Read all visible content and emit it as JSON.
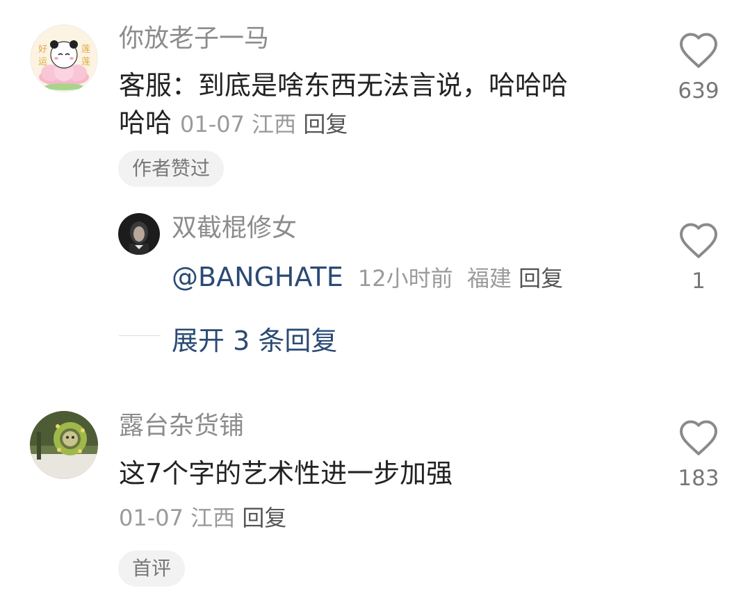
{
  "comments": [
    {
      "nickname": "你放老子一马",
      "content_line1": "客服：到底是啥东西无法言说，哈哈哈",
      "content_line2": "哈哈",
      "date": "01-07",
      "location": "江西",
      "reply_label": "回复",
      "badge": "作者赞过",
      "likes": "639",
      "avatar_icon": "panda-lotus-avatar",
      "avatar_text": {
        "left_top": "好",
        "left_bottom": "运",
        "right_top": "莲",
        "right_bottom": "莲"
      }
    },
    {
      "nickname": "露台杂货铺",
      "content": "这7个字的艺术性进一步加强",
      "date": "01-07",
      "location": "江西",
      "reply_label": "回复",
      "badge": "首评",
      "likes": "183",
      "avatar_icon": "plant-wreath-avatar"
    }
  ],
  "reply": {
    "nickname": "双截棍修女",
    "mention": "@BANGHATE",
    "time": "12小时前",
    "location": "福建",
    "reply_label": "回复",
    "likes": "1",
    "avatar_icon": "dark-portrait-avatar"
  },
  "expand_replies": "展开 3 条回复",
  "colors": {
    "nickname": "#8c8c8c",
    "content": "#222222",
    "meta": "#9a9a9a",
    "link_blue": "#2a4a74",
    "badge_bg": "#f2f2f2"
  }
}
